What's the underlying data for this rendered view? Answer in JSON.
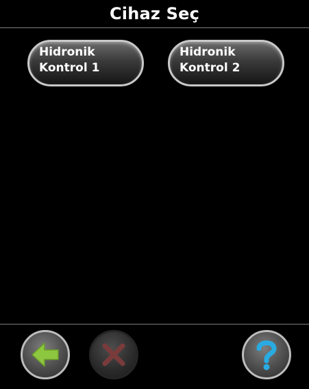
{
  "header": {
    "title": "Cihaz Seç"
  },
  "devices": [
    {
      "line1": "Hidronik",
      "line2": "Kontrol 1"
    },
    {
      "line1": "Hidronik",
      "line2": "Kontrol 2"
    }
  ],
  "footer": {
    "back_icon": "arrow-left-icon",
    "cancel_icon": "close-icon",
    "help_icon": "question-icon"
  },
  "colors": {
    "background": "#000000",
    "back_arrow": "#8dc63f",
    "cancel_x": "#7a3b3b",
    "help_mark": "#29abe2"
  }
}
